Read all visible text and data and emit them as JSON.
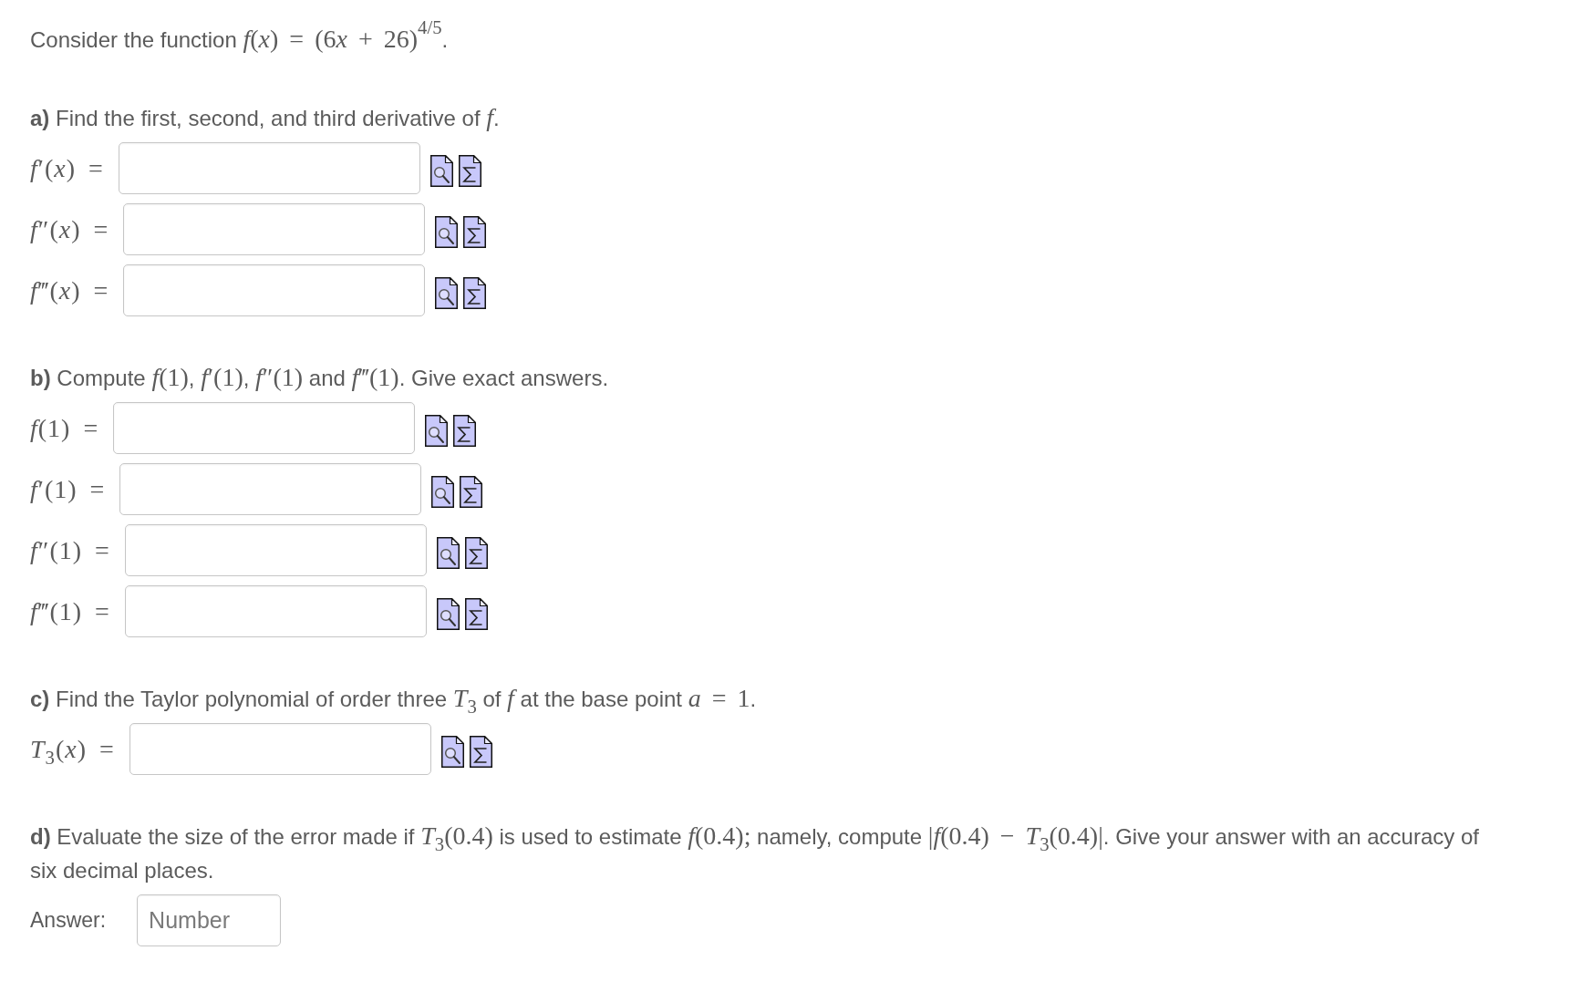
{
  "intro": [
    {
      "kind": "text",
      "text": "Consider the function "
    },
    {
      "kind": "math",
      "text": "*f*(*x*) = (6"
    },
    {
      "kind": "math",
      "text": "*x*"
    },
    {
      "kind": "math",
      "text": " + 26)$^{4/5}$"
    },
    {
      "kind": "text",
      "text": "."
    }
  ],
  "sections": [
    {
      "heading": [
        {
          "kind": "text",
          "text": "**a)** Find the first, second, and third derivative of "
        },
        {
          "kind": "math",
          "text": "*f*"
        },
        {
          "kind": "text",
          "text": "."
        }
      ],
      "fields": [
        {
          "kind": "formula",
          "label": "*f*′(*x*) ="
        },
        {
          "kind": "formula",
          "label": "*f*″(*x*) ="
        },
        {
          "kind": "formula",
          "label": "*f*‴(*x*) ="
        }
      ]
    },
    {
      "heading": [
        {
          "kind": "text",
          "text": "**b)** Compute "
        },
        {
          "kind": "math",
          "text": "*f*(1)"
        },
        {
          "kind": "text",
          "text": ", "
        },
        {
          "kind": "math",
          "text": "*f*′(1)"
        },
        {
          "kind": "text",
          "text": ", "
        },
        {
          "kind": "math",
          "text": "*f*″(1)"
        },
        {
          "kind": "text",
          "text": " and "
        },
        {
          "kind": "math",
          "text": "*f*‴(1)"
        },
        {
          "kind": "text",
          "text": ". Give exact answers."
        }
      ],
      "fields": [
        {
          "kind": "formula",
          "label": "*f*(1) ="
        },
        {
          "kind": "formula",
          "label": "*f*′(1) ="
        },
        {
          "kind": "formula",
          "label": "*f*″(1) ="
        },
        {
          "kind": "formula",
          "label": "*f*‴(1) ="
        }
      ]
    },
    {
      "heading": [
        {
          "kind": "text",
          "text": "**c)** Find the Taylor polynomial of order three "
        },
        {
          "kind": "math",
          "text": "*T*$_{3}$"
        },
        {
          "kind": "text",
          "text": " of "
        },
        {
          "kind": "math",
          "text": "*f*"
        },
        {
          "kind": "text",
          "text": " at the base point "
        },
        {
          "kind": "math",
          "text": "*a* = 1"
        },
        {
          "kind": "text",
          "text": "."
        }
      ],
      "fields": [
        {
          "kind": "formula",
          "label": "*T*$_{3}$(*x*) ="
        }
      ]
    },
    {
      "heading": [
        {
          "kind": "text",
          "text": "**d)** Evaluate the size of the error made if "
        },
        {
          "kind": "math",
          "text": "*T*$_{3}$(0.4)"
        },
        {
          "kind": "text",
          "text": " is used to estimate "
        },
        {
          "kind": "math",
          "text": "*f*(0.4);"
        },
        {
          "kind": "text",
          "text": " namely, compute "
        },
        {
          "kind": "math",
          "text": "|*f*(0.4) − *T*$_{3}$(0.4)|"
        },
        {
          "kind": "text",
          "text": ". Give your answer with an accuracy of six decimal places."
        }
      ],
      "fields": [
        {
          "kind": "number",
          "label": "Answer:",
          "placeholder": "Number"
        }
      ]
    }
  ]
}
